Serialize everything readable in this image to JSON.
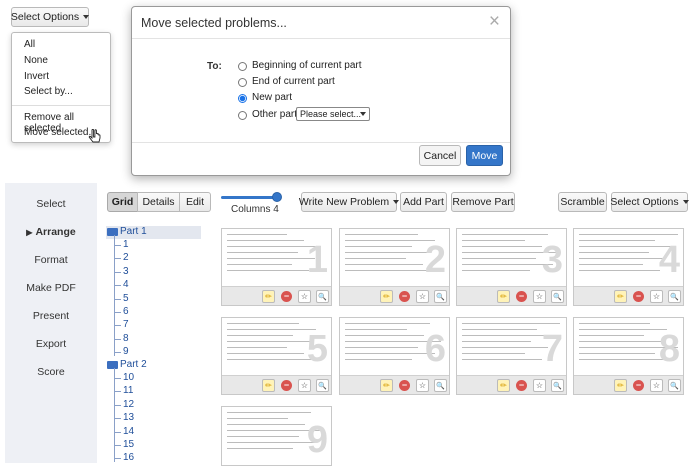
{
  "top_select_button": "Select Options",
  "select_menu": {
    "items": [
      "All",
      "None",
      "Invert",
      "Select by..."
    ],
    "items2": [
      "Remove all selected",
      "Move selected..."
    ]
  },
  "modal": {
    "title": "Move selected problems...",
    "close": "×",
    "to_label": "To:",
    "options": [
      "Beginning of current part",
      "End of current part",
      "New part",
      "Other part"
    ],
    "selected_option": "New part",
    "other_select_placeholder": "Please select...",
    "cancel": "Cancel",
    "move": "Move"
  },
  "sidebar": {
    "items": [
      "Select",
      "Arrange",
      "Format",
      "Make PDF",
      "Present",
      "Export",
      "Score"
    ],
    "active": "Arrange"
  },
  "view_tabs": [
    "Grid",
    "Details",
    "Edit"
  ],
  "active_view": "Grid",
  "columns_label": "Columns 4",
  "toolbar": {
    "write_new": "Write New Problem",
    "add_part": "Add Part",
    "remove_part": "Remove Part",
    "scramble": "Scramble",
    "select_options": "Select Options"
  },
  "tree": {
    "part1": "Part 1",
    "part1_items": [
      "1",
      "2",
      "3",
      "4",
      "5",
      "6",
      "7",
      "8",
      "9"
    ],
    "part2": "Part 2",
    "part2_items": [
      "10",
      "11",
      "12",
      "13",
      "14",
      "15",
      "16"
    ]
  },
  "cards": [
    "1",
    "2",
    "3",
    "4",
    "5",
    "6",
    "7",
    "8",
    "9"
  ],
  "card_buttons": {
    "edit": "✏",
    "remove": "−",
    "star": "☆",
    "zoom": "🔍"
  },
  "colors": {
    "primary": "#3476c9",
    "sidebar_bg": "#eef0f5",
    "tree_link": "#1f4e99"
  }
}
